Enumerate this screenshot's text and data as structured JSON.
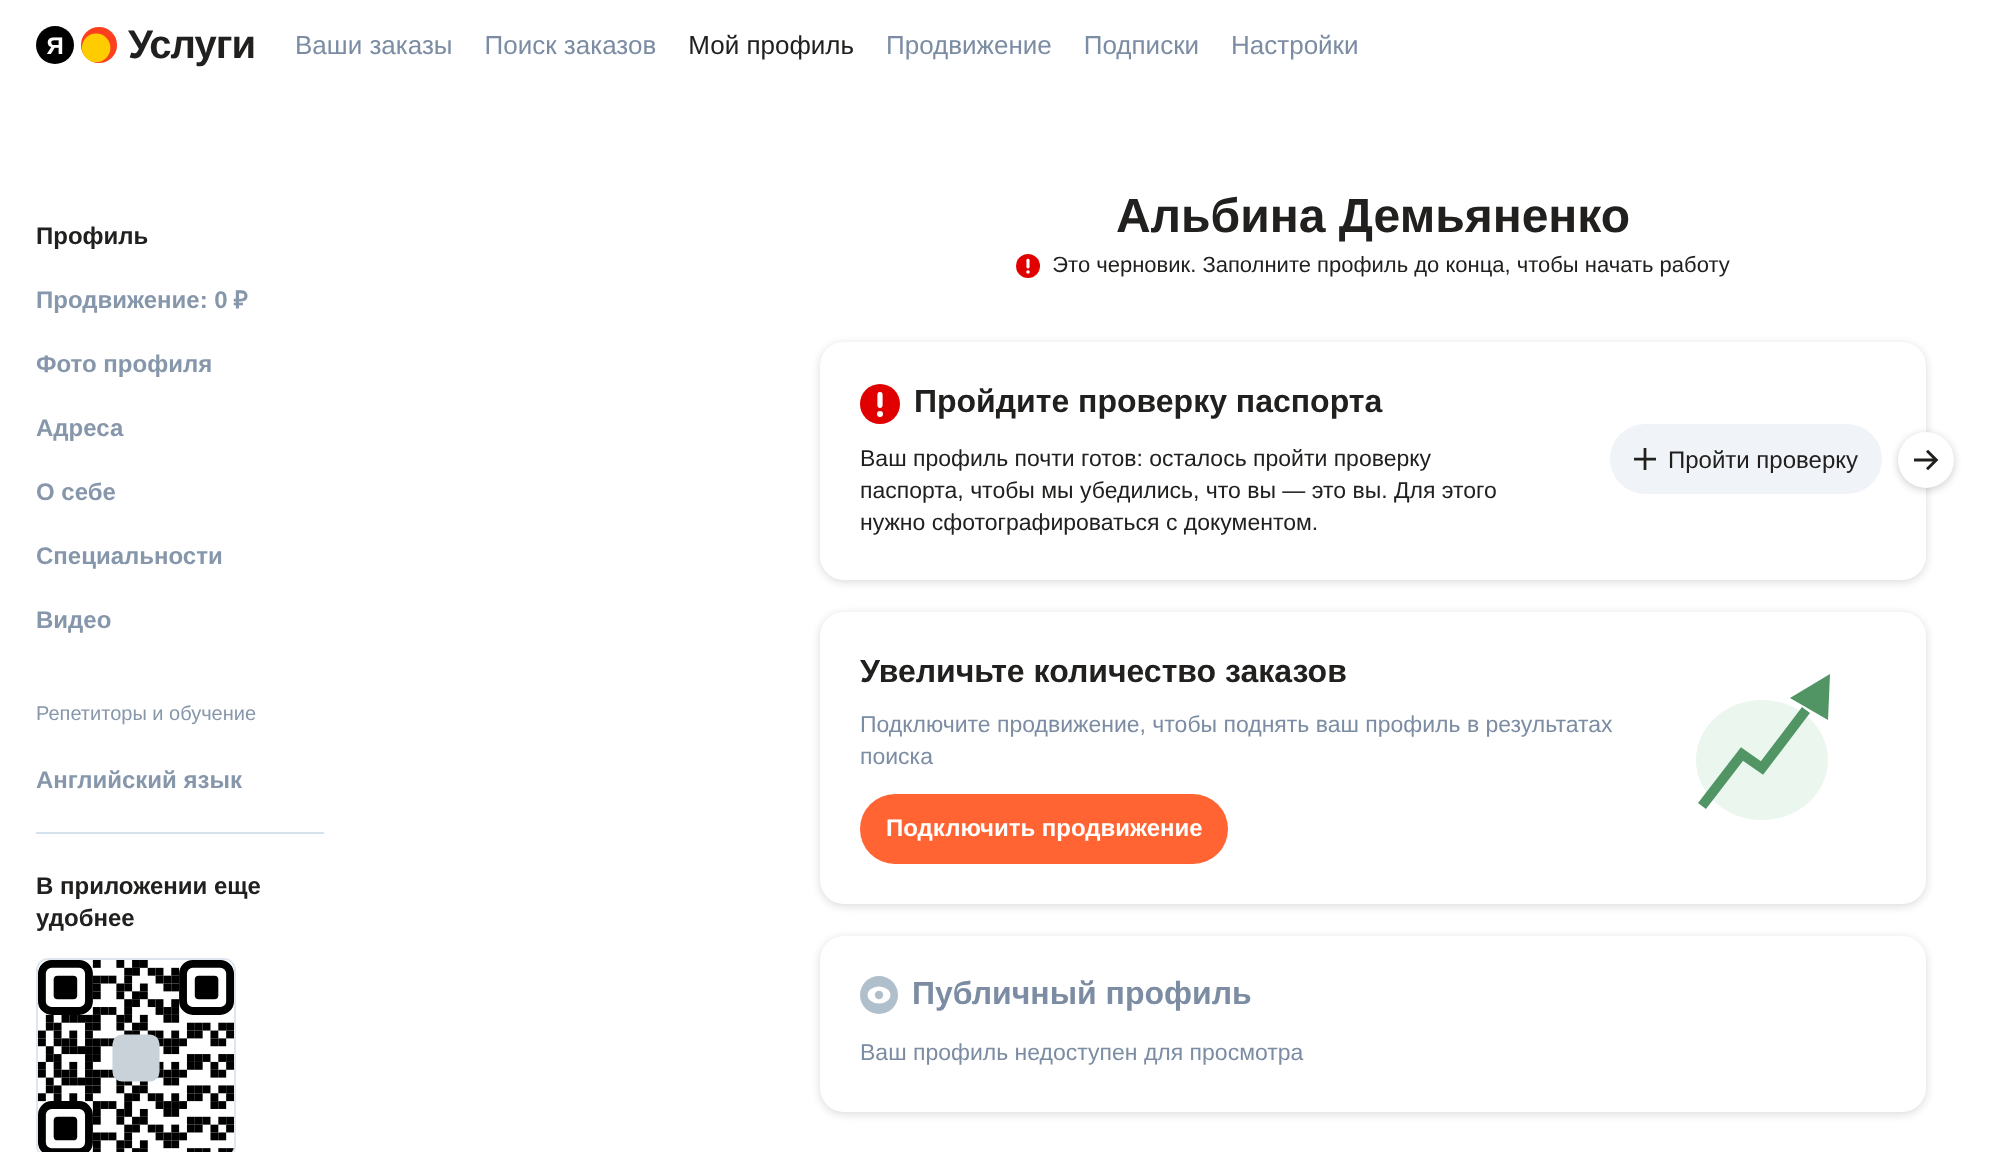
{
  "logo": {
    "mark": "Я",
    "text": "Услуги"
  },
  "nav": [
    {
      "label": "Ваши заказы",
      "selected": false
    },
    {
      "label": "Поиск заказов",
      "selected": false
    },
    {
      "label": "Мой профиль",
      "selected": true
    },
    {
      "label": "Продвижение",
      "selected": false
    },
    {
      "label": "Подписки",
      "selected": false
    },
    {
      "label": "Настройки",
      "selected": false
    }
  ],
  "sidebar": {
    "items": [
      {
        "label": "Профиль",
        "selected": true
      },
      {
        "label": "Продвижение: 0 ₽",
        "selected": false
      },
      {
        "label": "Фото профиля",
        "selected": false
      },
      {
        "label": "Адреса",
        "selected": false
      },
      {
        "label": "О себе",
        "selected": false
      },
      {
        "label": "Специальности",
        "selected": false
      },
      {
        "label": "Видео",
        "selected": false
      }
    ],
    "section": {
      "title": "Репетиторы и обучение",
      "items": [
        {
          "label": "Английский язык",
          "selected": false
        }
      ]
    },
    "app_promo": "В приложении еще удобнее"
  },
  "profile": {
    "name": "Альбина Демьяненко",
    "warning": "Это черновик. Заполните профиль до конца, чтобы начать работу"
  },
  "cards": [
    {
      "kind": "passport",
      "title": "Пройдите проверку паспорта",
      "text": "Ваш профиль почти готов: осталось пройти проверку паспорта, чтобы мы убедились, что вы — это вы. Для этого нужно сфотографироваться с документом.",
      "button": "Пройти проверку"
    },
    {
      "kind": "promo",
      "title": "Увеличьте количество заказов",
      "text": "Подключите продвижение, чтобы поднять ваш профиль в результатах поиска",
      "button": "Подключить продвижение"
    },
    {
      "kind": "public",
      "title": "Публичный профиль",
      "text": "Ваш профиль недоступен для просмотра"
    }
  ]
}
